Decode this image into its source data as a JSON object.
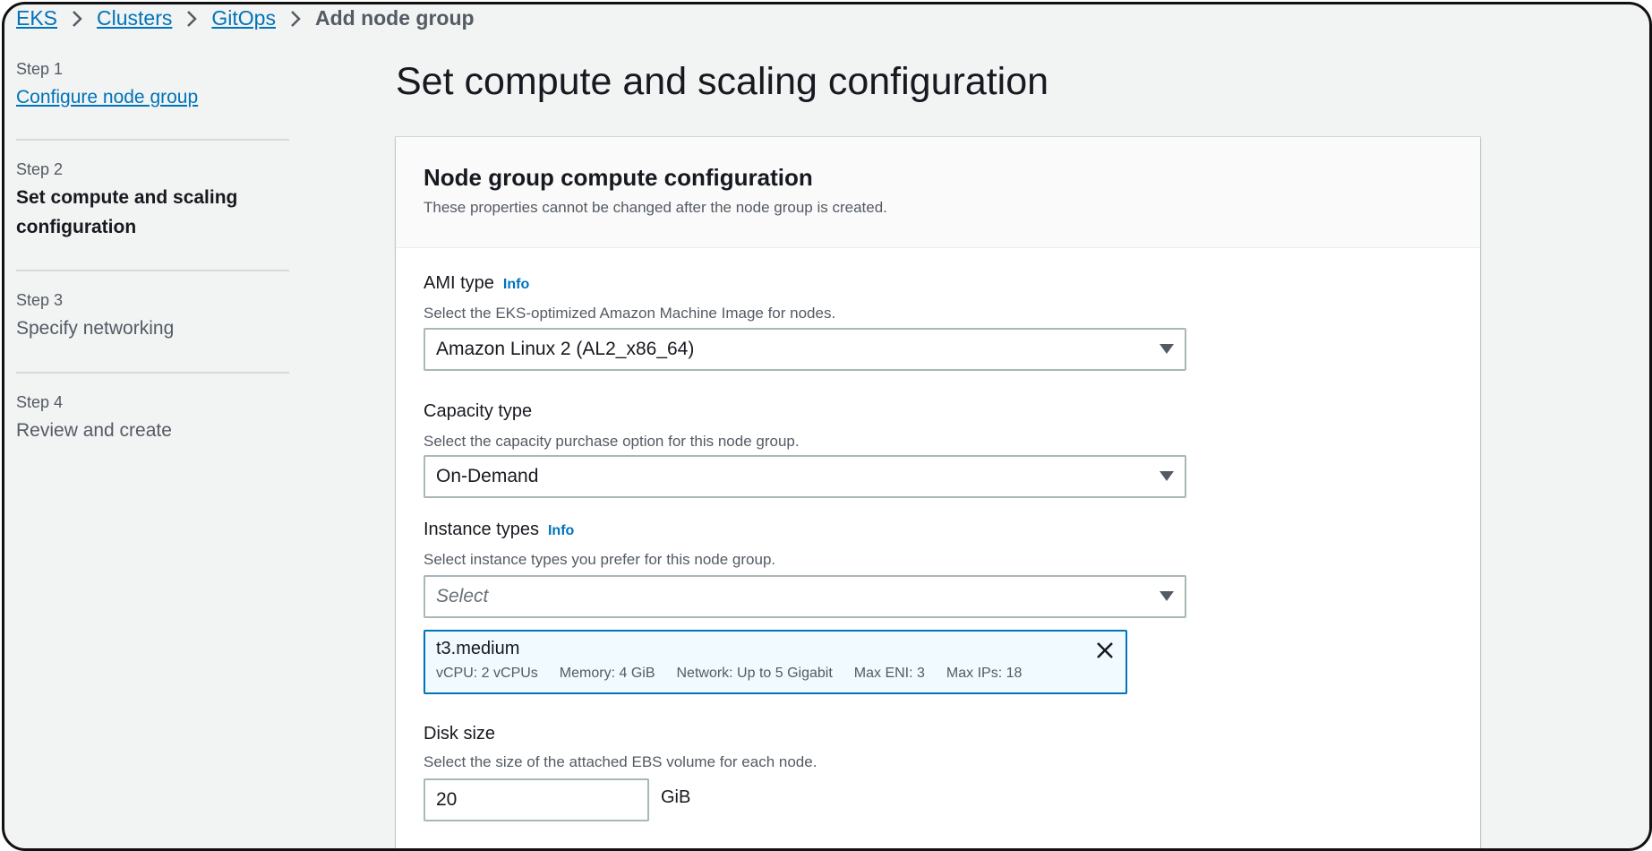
{
  "breadcrumb": {
    "items": [
      "EKS",
      "Clusters",
      "GitOps"
    ],
    "current": "Add node group"
  },
  "steps": [
    {
      "num": "Step 1",
      "label": "Configure node group",
      "state": "link"
    },
    {
      "num": "Step 2",
      "label": "Set compute and scaling configuration",
      "state": "active"
    },
    {
      "num": "Step 3",
      "label": "Specify networking",
      "state": "disabled"
    },
    {
      "num": "Step 4",
      "label": "Review and create",
      "state": "disabled"
    }
  ],
  "page_title": "Set compute and scaling configuration",
  "card": {
    "title": "Node group compute configuration",
    "description": "These properties cannot be changed after the node group is created."
  },
  "ami": {
    "label": "AMI type",
    "info": "Info",
    "description": "Select the EKS-optimized Amazon Machine Image for nodes.",
    "value": "Amazon Linux 2 (AL2_x86_64)"
  },
  "capacity": {
    "label": "Capacity type",
    "description": "Select the capacity purchase option for this node group.",
    "value": "On-Demand"
  },
  "instance_types": {
    "label": "Instance types",
    "info": "Info",
    "description": "Select instance types you prefer for this node group.",
    "placeholder": "Select",
    "token": {
      "name": "t3.medium",
      "vcpu": "vCPU: 2 vCPUs",
      "memory": "Memory: 4 GiB",
      "network": "Network: Up to 5 Gigabit",
      "max_eni": "Max ENI: 3",
      "max_ips": "Max IPs: 18"
    }
  },
  "disk": {
    "label": "Disk size",
    "description": "Select the size of the attached EBS volume for each node.",
    "value": "20",
    "unit": "GiB"
  },
  "colors": {
    "link": "#0073bb",
    "text": "#16191f",
    "muted": "#545b64",
    "background": "#f2f3f3",
    "token_bg": "#f1faff"
  }
}
